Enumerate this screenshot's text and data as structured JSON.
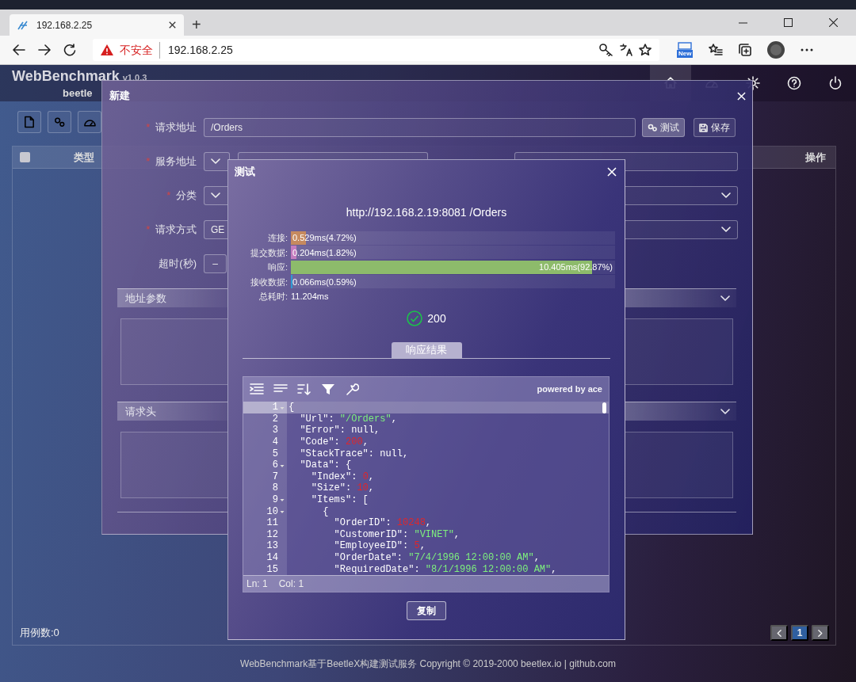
{
  "browser": {
    "tab": {
      "title": "192.168.2.25"
    },
    "new_tab": "+",
    "security": "不安全",
    "url": "192.168.2.25",
    "extension_badge": "New"
  },
  "app": {
    "title": "WebBenchmark",
    "version": "v1.0.3",
    "subtitle": "beetle"
  },
  "table": {
    "select_all": {
      "checked": false
    },
    "columns": [
      "类型",
      "操作"
    ]
  },
  "footer": {
    "count": "用例数:0",
    "pages": [
      {
        "label": "1",
        "selected": true
      }
    ],
    "copyright": "WebBenchmark基于BeetleX构建测试服务 Copyright © 2019-2000 beetlex.io | github.com"
  },
  "new_dialog": {
    "title": "新建",
    "fields": [
      {
        "kind": "text",
        "label": "请求地址",
        "required_mark": "*",
        "value": "/Orders"
      },
      {
        "kind": "addon",
        "label": "服务地址",
        "required_mark": "*"
      },
      {
        "kind": "addon",
        "label": "分类",
        "required_mark": "*"
      },
      {
        "kind": "select",
        "label": "请求方式",
        "required_mark": "*",
        "value": "GE"
      },
      {
        "kind": "stepper",
        "label": "超时(秒)",
        "button": "–"
      }
    ],
    "buttons": [
      "测试",
      "保存"
    ],
    "sections": [
      "地址参数",
      "请求头"
    ]
  },
  "test_dialog": {
    "title": "测试",
    "url": "http://192.168.2.19:8081 /Orders",
    "timings": [
      {
        "label": "连接:",
        "reading": "0.529ms(4.72%)",
        "level": 0.0472,
        "color": "#c68a5f"
      },
      {
        "label": "提交数据:",
        "reading": "0.204ms(1.82%)",
        "level": 0.0182,
        "color": "#c47cbf"
      },
      {
        "label": "响应:",
        "reading": "10.405ms(92.87%)",
        "level": 0.9287,
        "color": "#8dbb6b"
      },
      {
        "label": "接收数据:",
        "reading": "0.066ms(0.59%)",
        "level": 0.0059,
        "color": "#2f9ad4"
      }
    ],
    "total": {
      "label": "总耗时:",
      "value": "11.204ms"
    },
    "status": "200",
    "tabs": [
      {
        "label": "响应结果",
        "selected": true
      }
    ],
    "editor": {
      "brand": "powered by ace",
      "lines": [
        {
          "number": "1",
          "fold": true,
          "active": true,
          "tokens": [
            {
              "kind": "plain",
              "text": "{"
            }
          ]
        },
        {
          "number": "2",
          "fold": false,
          "active": false,
          "tokens": [
            {
              "kind": "plain",
              "text": "  \"Url\": "
            },
            {
              "kind": "string",
              "text": "\"/Orders\""
            },
            {
              "kind": "plain",
              "text": ","
            }
          ]
        },
        {
          "number": "3",
          "fold": false,
          "active": false,
          "tokens": [
            {
              "kind": "plain",
              "text": "  \"Error\": null,"
            }
          ]
        },
        {
          "number": "4",
          "fold": false,
          "active": false,
          "tokens": [
            {
              "kind": "plain",
              "text": "  \"Code\": "
            },
            {
              "kind": "number",
              "text": "200"
            },
            {
              "kind": "plain",
              "text": ","
            }
          ]
        },
        {
          "number": "5",
          "fold": false,
          "active": false,
          "tokens": [
            {
              "kind": "plain",
              "text": "  \"StackTrace\": null,"
            }
          ]
        },
        {
          "number": "6",
          "fold": true,
          "active": false,
          "tokens": [
            {
              "kind": "plain",
              "text": "  \"Data\": {"
            }
          ]
        },
        {
          "number": "7",
          "fold": false,
          "active": false,
          "tokens": [
            {
              "kind": "plain",
              "text": "    \"Index\": "
            },
            {
              "kind": "number",
              "text": "0"
            },
            {
              "kind": "plain",
              "text": ","
            }
          ]
        },
        {
          "number": "8",
          "fold": false,
          "active": false,
          "tokens": [
            {
              "kind": "plain",
              "text": "    \"Size\": "
            },
            {
              "kind": "number",
              "text": "10"
            },
            {
              "kind": "plain",
              "text": ","
            }
          ]
        },
        {
          "number": "9",
          "fold": true,
          "active": false,
          "tokens": [
            {
              "kind": "plain",
              "text": "    \"Items\": ["
            }
          ]
        },
        {
          "number": "10",
          "fold": true,
          "active": false,
          "tokens": [
            {
              "kind": "plain",
              "text": "      {"
            }
          ]
        },
        {
          "number": "11",
          "fold": false,
          "active": false,
          "tokens": [
            {
              "kind": "plain",
              "text": "        \"OrderID\": "
            },
            {
              "kind": "number",
              "text": "10248"
            },
            {
              "kind": "plain",
              "text": ","
            }
          ]
        },
        {
          "number": "12",
          "fold": false,
          "active": false,
          "tokens": [
            {
              "kind": "plain",
              "text": "        \"CustomerID\": "
            },
            {
              "kind": "string",
              "text": "\"VINET\""
            },
            {
              "kind": "plain",
              "text": ","
            }
          ]
        },
        {
          "number": "13",
          "fold": false,
          "active": false,
          "tokens": [
            {
              "kind": "plain",
              "text": "        \"EmployeeID\": "
            },
            {
              "kind": "number",
              "text": "5"
            },
            {
              "kind": "plain",
              "text": ","
            }
          ]
        },
        {
          "number": "14",
          "fold": false,
          "active": false,
          "tokens": [
            {
              "kind": "plain",
              "text": "        \"OrderDate\": "
            },
            {
              "kind": "string",
              "text": "\"7/4/1996 12:00:00 AM\""
            },
            {
              "kind": "plain",
              "text": ","
            }
          ]
        },
        {
          "number": "15",
          "fold": false,
          "active": false,
          "tokens": [
            {
              "kind": "plain",
              "text": "        \"RequiredDate\": "
            },
            {
              "kind": "string",
              "text": "\"8/1/1996 12:00:00 AM\""
            },
            {
              "kind": "plain",
              "text": ","
            }
          ]
        }
      ],
      "status": [
        "Ln: 1",
        "Col: 1"
      ]
    },
    "copy_button": "复制"
  }
}
